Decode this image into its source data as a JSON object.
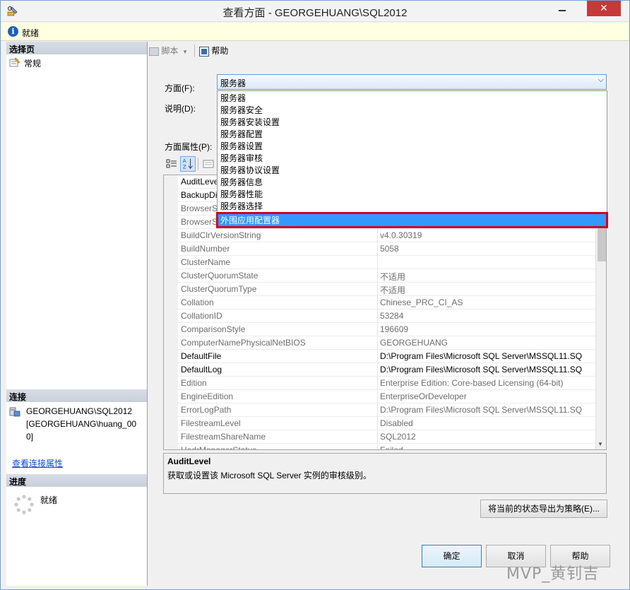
{
  "window": {
    "title": "查看方面 - GEORGEHUANG\\SQL2012",
    "close_glyph": "✕"
  },
  "message_bar": {
    "text": "就绪"
  },
  "left_panel": {
    "pages_header": "选择页",
    "pages": [
      {
        "label": "常规",
        "icon": "properties-page-icon"
      }
    ],
    "connection_header": "连接",
    "connection_lines": [
      "GEORGEHUANG\\SQL2012",
      "[GEORGEHUANG\\huang_00",
      "0]"
    ],
    "connection_link": "查看连接属性",
    "progress_header": "进度",
    "progress_status": "就绪"
  },
  "toolbar": {
    "script_label": "脚本",
    "help_label": "帮助"
  },
  "facet": {
    "label": "方面(F):",
    "selected": "服务器",
    "description_label": "说明(D):",
    "properties_label": "方面属性(P):",
    "options": [
      "服务器",
      "服务器安全",
      "服务器安装设置",
      "服务器配置",
      "服务器设置",
      "服务器审核",
      "服务器协议设置",
      "服务器信息",
      "服务器性能",
      "服务器选择",
      "外围应用配置器"
    ],
    "highlighted_option": "外围应用配置器",
    "highlight_color": "#d0001b"
  },
  "properties": {
    "rows": [
      {
        "name": "AuditLevel",
        "value": "",
        "editable": true
      },
      {
        "name": "BackupDirectory",
        "value": "",
        "editable": true
      },
      {
        "name": "BrowserServiceAccount",
        "value": "",
        "editable": false
      },
      {
        "name": "BrowserStartMode",
        "value": "",
        "editable": false
      },
      {
        "name": "BuildClrVersionString",
        "value": "v4.0.30319",
        "editable": false
      },
      {
        "name": "BuildNumber",
        "value": "5058",
        "editable": false
      },
      {
        "name": "ClusterName",
        "value": "",
        "editable": false
      },
      {
        "name": "ClusterQuorumState",
        "value": "不适用",
        "editable": false
      },
      {
        "name": "ClusterQuorumType",
        "value": "不适用",
        "editable": false
      },
      {
        "name": "Collation",
        "value": "Chinese_PRC_CI_AS",
        "editable": false
      },
      {
        "name": "CollationID",
        "value": "53284",
        "editable": false
      },
      {
        "name": "ComparisonStyle",
        "value": "196609",
        "editable": false
      },
      {
        "name": "ComputerNamePhysicalNetBIOS",
        "value": "GEORGEHUANG",
        "editable": false
      },
      {
        "name": "DefaultFile",
        "value": "D:\\Program Files\\Microsoft SQL Server\\MSSQL11.SQ",
        "editable": true
      },
      {
        "name": "DefaultLog",
        "value": "D:\\Program Files\\Microsoft SQL Server\\MSSQL11.SQ",
        "editable": true
      },
      {
        "name": "Edition",
        "value": "Enterprise Edition: Core-based Licensing (64-bit)",
        "editable": false
      },
      {
        "name": "EngineEdition",
        "value": "EnterpriseOrDeveloper",
        "editable": false
      },
      {
        "name": "ErrorLogPath",
        "value": "D:\\Program Files\\Microsoft SQL Server\\MSSQL11.SQ",
        "editable": false
      },
      {
        "name": "FilestreamLevel",
        "value": "Disabled",
        "editable": false
      },
      {
        "name": "FilestreamShareName",
        "value": "SQL2012",
        "editable": false
      },
      {
        "name": "HadrManagerStatus",
        "value": "Failed",
        "editable": false
      }
    ]
  },
  "description": {
    "title": "AuditLevel",
    "text": "获取或设置该 Microsoft SQL Server 实例的审核级别。"
  },
  "buttons": {
    "export": "将当前的状态导出为策略(E)...",
    "ok": "确定",
    "cancel": "取消",
    "help": "帮助"
  },
  "watermark": "MVP_黄钊吉"
}
